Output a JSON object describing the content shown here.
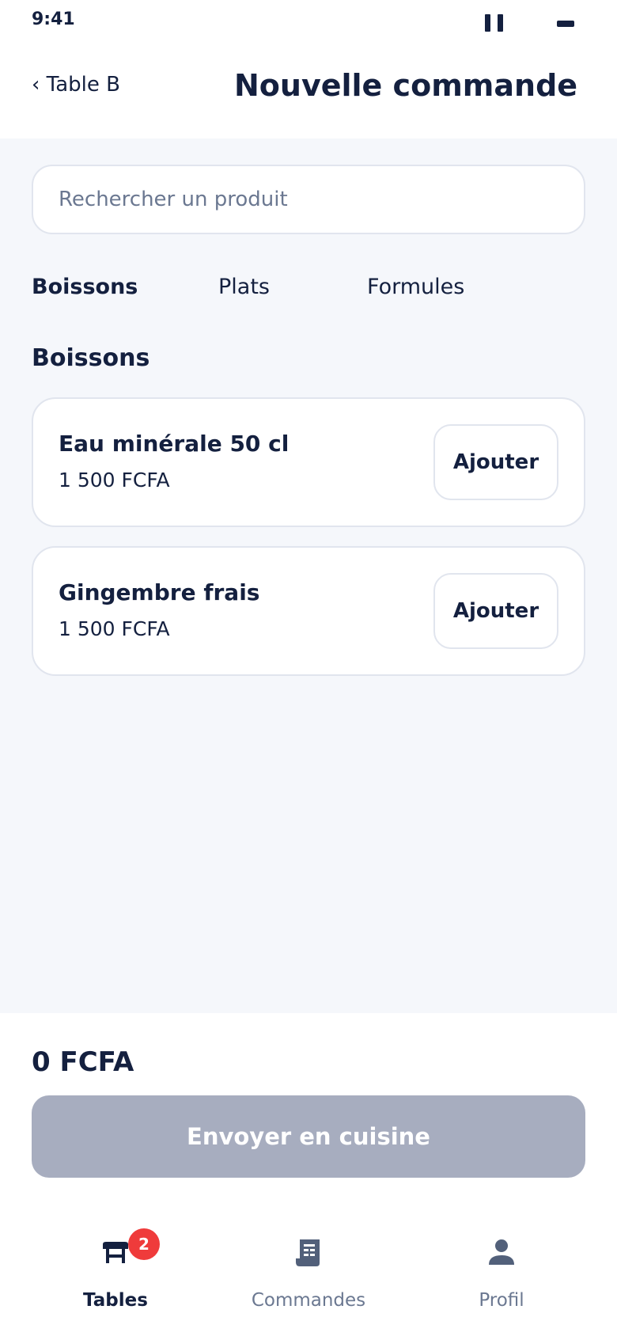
{
  "status_bar": {
    "time": "9:41"
  },
  "header": {
    "back_label": "‹ Table B",
    "title": "Nouvelle commande"
  },
  "search": {
    "placeholder": "Rechercher un produit",
    "value": ""
  },
  "tabs": [
    {
      "label": "Boissons",
      "active": true
    },
    {
      "label": "Plats",
      "active": false
    },
    {
      "label": "Formules",
      "active": false
    }
  ],
  "section": {
    "title": "Boissons"
  },
  "products": [
    {
      "name": "Eau minérale 50 cl",
      "price": "1 500 FCFA",
      "add_label": "Ajouter"
    },
    {
      "name": "Gingembre frais",
      "price": "1 500 FCFA",
      "add_label": "Ajouter"
    }
  ],
  "order": {
    "total": "0 FCFA",
    "send_label": "Envoyer en cuisine",
    "send_enabled": false
  },
  "bottom_nav": {
    "items": [
      {
        "label": "Tables",
        "icon": "table-icon",
        "active": true,
        "badge": "2"
      },
      {
        "label": "Commandes",
        "icon": "receipt-icon",
        "active": false
      },
      {
        "label": "Profil",
        "icon": "person-icon",
        "active": false
      }
    ]
  },
  "colors": {
    "primary": "#14203f",
    "muted": "#6b7891",
    "background": "#f5f7fb",
    "border": "#e1e5ee",
    "disabled_button": "#a7adbf",
    "badge": "#ef3b3b"
  }
}
